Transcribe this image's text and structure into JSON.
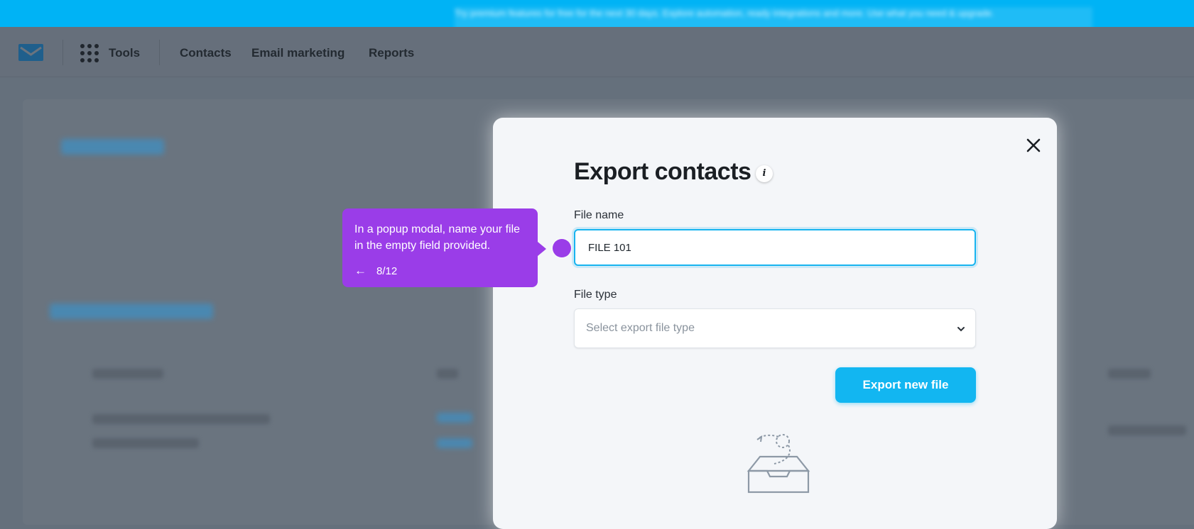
{
  "banner": {
    "text": "Try premium features for free for the next 30 days. Explore automation, ready integrations and more. Use what you need & upgrade."
  },
  "nav": {
    "tools_label": "Tools",
    "links": [
      "Contacts",
      "Email marketing",
      "Reports"
    ]
  },
  "modal": {
    "title": "Export contacts",
    "info_glyph": "i",
    "file_name_label": "File name",
    "file_name_value": "FILE 101",
    "file_type_label": "File type",
    "file_type_placeholder": "Select export file type",
    "export_button_label": "Export new file"
  },
  "tooltip": {
    "text": "In a popup modal, name your file in the empty field provided.",
    "back_glyph": "←",
    "step": "8/12"
  },
  "colors": {
    "banner": "#00b3f5",
    "accent": "#12b6f1",
    "tooltip": "#9a3de8",
    "overlay": "#65707c"
  },
  "icons": [
    "envelope-logo-icon",
    "apps-grid-icon",
    "close-icon",
    "info-icon",
    "chevron-down-icon",
    "empty-inbox-icon",
    "arrow-left-icon"
  ]
}
